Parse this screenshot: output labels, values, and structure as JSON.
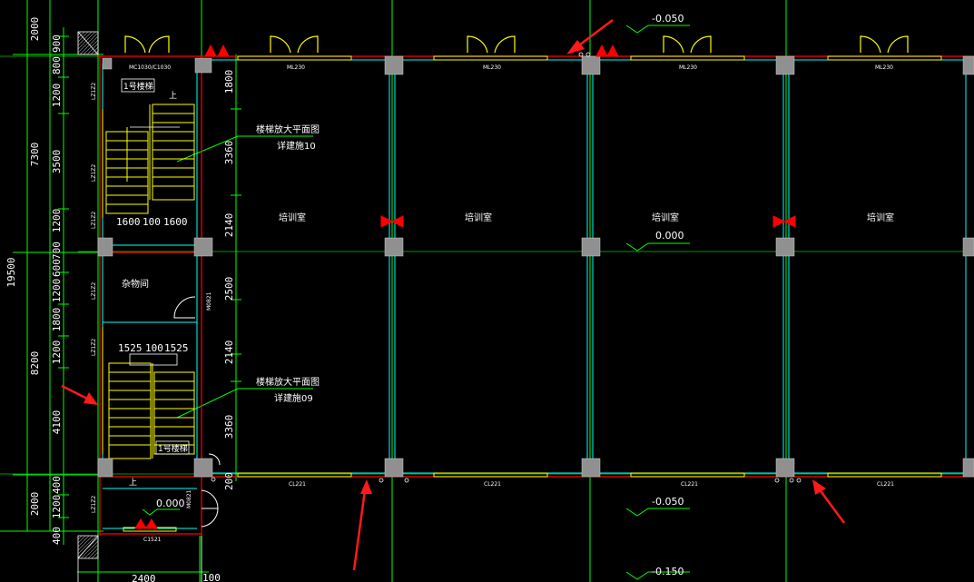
{
  "drawing": {
    "rooms": {
      "training_1": "培训室",
      "training_2": "培训室",
      "training_3": "培训室",
      "training_4": "培训室",
      "storage": "杂物间"
    },
    "stair_notes": {
      "upper_title": "楼梯放大平面图",
      "upper_ref": "详建施10",
      "lower_title": "楼梯放大平面图",
      "lower_ref": "详建施09",
      "upper_tag": "1号楼梯",
      "lower_tag": "1号楼梯",
      "up_mark_1": "上",
      "up_mark_2": "上"
    },
    "levels": {
      "top": "-0.050",
      "middle": "0.000",
      "stair_entry": "0.000",
      "bottom1": "-0.050",
      "bottom2": "-0.150"
    },
    "window_tags": {
      "top_1": "ML230",
      "top_2": "ML230",
      "top_3": "ML230",
      "top_4": "ML230",
      "corner": "MC1030/C1030",
      "bottom_1": "CL221",
      "bottom_2": "CL221",
      "bottom_3": "CL221",
      "bottom_4": "CL221",
      "stair_bottom": "C1521"
    },
    "dims_left_total": "19500",
    "dims_left_outer": [
      "2000",
      "7300",
      "8200",
      "2000"
    ],
    "dims_left_inner": [
      "900",
      "800",
      "1200",
      "3500",
      "1200",
      "700",
      "600",
      "1200",
      "1800",
      "1200",
      "4100",
      "400",
      "1200",
      "400"
    ],
    "dims_middle": [
      "1800",
      "3360",
      "2140",
      "2500",
      "2140",
      "3360",
      "200"
    ],
    "dims_stair_upper": [
      "1600",
      "100",
      "1600"
    ],
    "dims_stair_lower": [
      "1525",
      "100",
      "1525"
    ],
    "dims_bottom": [
      "100",
      "2400"
    ],
    "side_tags": {
      "left_1": "LZ1Z2",
      "left_2": "LZ1Z2",
      "left_3": "LZ1Z2",
      "left_4": "LZ1Z2",
      "left_5": "LZ1Z2",
      "left_6": "LZ1Z2",
      "right_1": "M0821",
      "right_2": "M0821"
    }
  },
  "colors": {
    "background": "#000000",
    "grid": "#00ff00",
    "wall": "#ff0000",
    "glazing": "#00ffff",
    "stair": "#ffff00",
    "column": "#909090",
    "arrow": "#ff1a1a"
  }
}
